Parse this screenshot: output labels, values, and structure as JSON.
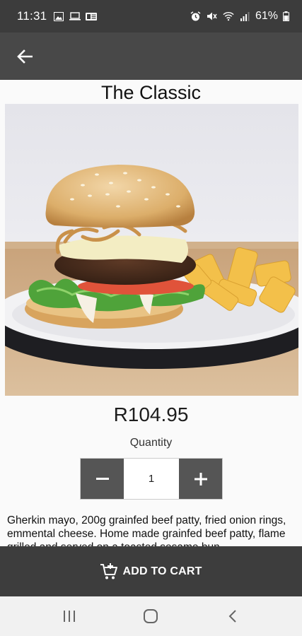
{
  "status_bar": {
    "time": "11:31",
    "battery": "61%",
    "left_icons": [
      "image-icon",
      "laptop-icon",
      "outlook-icon"
    ],
    "right_icons": [
      "alarm-icon",
      "mute-icon",
      "wifi-icon",
      "signal-icon",
      "battery-icon"
    ]
  },
  "app_bar": {
    "back_icon": "arrow-left-icon"
  },
  "product": {
    "title": "The Classic",
    "price": "R104.95",
    "quantity_label": "Quantity",
    "quantity": "1",
    "minus_label": "−",
    "plus_label": "+",
    "description": "Gherkin mayo, 200g grainfed beef patty, fried onion rings, emmental cheese. Home made grainfed beef patty, flame grilled and served on a toasted sesame bun."
  },
  "cart": {
    "label": "ADD TO CART",
    "icon": "cart-plus-icon"
  },
  "nav": {
    "recents_icon": "recents-icon",
    "home_icon": "home-icon",
    "back_icon": "nav-back-icon"
  }
}
